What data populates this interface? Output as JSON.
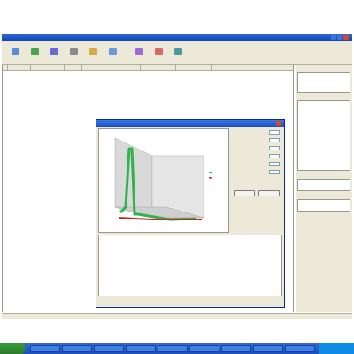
{
  "window": {
    "title": ""
  },
  "toolbar": {
    "items": [
      {
        "label": "",
        "icon": "edit-icon"
      },
      {
        "label": "",
        "icon": "refresh-icon"
      },
      {
        "label": "",
        "icon": "save-icon"
      },
      {
        "label": "",
        "icon": "print-icon"
      },
      {
        "label": "",
        "icon": "find-icon"
      },
      {
        "label": "",
        "icon": "options-icon"
      },
      {
        "label": "",
        "icon": "select-icon"
      },
      {
        "label": "",
        "icon": "lock-icon"
      },
      {
        "label": "",
        "icon": "tools-icon"
      }
    ]
  },
  "grid": {
    "title": "",
    "columns": [
      "",
      "",
      "",
      "",
      "",
      "",
      "",
      "",
      ""
    ],
    "rows": []
  },
  "side_panel": {
    "search_label": "",
    "criteria_label": "",
    "stats_label": "",
    "result_label": ""
  },
  "dialog": {
    "title": "",
    "chart_data": {
      "type": "line",
      "title": "",
      "series": [
        {
          "name": "",
          "color": "#2fb34a"
        },
        {
          "name": "",
          "color": "#c0282a"
        }
      ]
    },
    "table_rows": [],
    "form_fields": [
      {
        "label": "",
        "value": ""
      },
      {
        "label": "",
        "value": ""
      },
      {
        "label": "",
        "value": ""
      },
      {
        "label": "",
        "value": ""
      },
      {
        "label": "",
        "value": ""
      },
      {
        "label": "",
        "value": ""
      }
    ],
    "buttons": [
      "",
      ""
    ]
  },
  "status": {
    "text": ""
  },
  "taskbar": {
    "start": "",
    "items": [
      "",
      "",
      "",
      "",
      "",
      "",
      "",
      "",
      ""
    ],
    "clock": ""
  },
  "colors": {
    "title_bar": "#1248b8",
    "chrome": "#ece9d8",
    "taskbar": "#1d4fb8",
    "start": "#2a7a2a"
  }
}
